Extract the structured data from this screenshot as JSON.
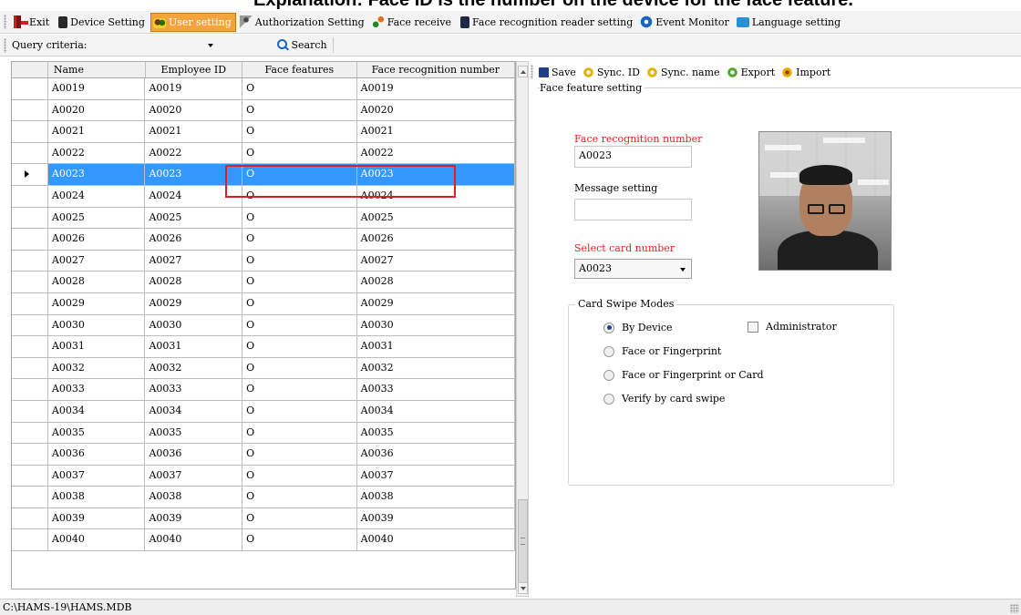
{
  "caption": "Explanation: Face ID is the number on the device for the face feature.",
  "menubar": {
    "items": [
      {
        "label": "Exit",
        "icon": "exit-icon",
        "active": false
      },
      {
        "label": "Device Setting",
        "icon": "device-icon",
        "active": false
      },
      {
        "label": "User setting",
        "icon": "user-setting-icon",
        "active": true
      },
      {
        "label": "Authorization Setting",
        "icon": "authorization-icon",
        "active": false
      },
      {
        "label": "Face receive",
        "icon": "face-receive-icon",
        "active": false
      },
      {
        "label": "Face recognition reader setting",
        "icon": "reader-icon",
        "active": false
      },
      {
        "label": "Event Monitor",
        "icon": "event-monitor-icon",
        "active": false
      },
      {
        "label": "Language setting",
        "icon": "language-icon",
        "active": false
      }
    ]
  },
  "query": {
    "label": "Query criteria:",
    "value": "",
    "search_label": "Search"
  },
  "grid": {
    "columns": [
      "Name",
      "Employee ID",
      "Face features",
      "Face recognition number"
    ],
    "selected_index": 4,
    "rows": [
      [
        "A0019",
        "A0019",
        "O",
        "A0019"
      ],
      [
        "A0020",
        "A0020",
        "O",
        "A0020"
      ],
      [
        "A0021",
        "A0021",
        "O",
        "A0021"
      ],
      [
        "A0022",
        "A0022",
        "O",
        "A0022"
      ],
      [
        "A0023",
        "A0023",
        "O",
        "A0023"
      ],
      [
        "A0024",
        "A0024",
        "O",
        "A0024"
      ],
      [
        "A0025",
        "A0025",
        "O",
        "A0025"
      ],
      [
        "A0026",
        "A0026",
        "O",
        "A0026"
      ],
      [
        "A0027",
        "A0027",
        "O",
        "A0027"
      ],
      [
        "A0028",
        "A0028",
        "O",
        "A0028"
      ],
      [
        "A0029",
        "A0029",
        "O",
        "A0029"
      ],
      [
        "A0030",
        "A0030",
        "O",
        "A0030"
      ],
      [
        "A0031",
        "A0031",
        "O",
        "A0031"
      ],
      [
        "A0032",
        "A0032",
        "O",
        "A0032"
      ],
      [
        "A0033",
        "A0033",
        "O",
        "A0033"
      ],
      [
        "A0034",
        "A0034",
        "O",
        "A0034"
      ],
      [
        "A0035",
        "A0035",
        "O",
        "A0035"
      ],
      [
        "A0036",
        "A0036",
        "O",
        "A0036"
      ],
      [
        "A0037",
        "A0037",
        "O",
        "A0037"
      ],
      [
        "A0038",
        "A0038",
        "O",
        "A0038"
      ],
      [
        "A0039",
        "A0039",
        "O",
        "A0039"
      ],
      [
        "A0040",
        "A0040",
        "O",
        "A0040"
      ]
    ]
  },
  "toolbar": {
    "save": "Save",
    "sync_id": "Sync. ID",
    "sync_name": "Sync. name",
    "export": "Export",
    "import": "Import"
  },
  "face_setting": {
    "group_title": "Face feature setting",
    "recognition_label": "Face recognition number",
    "recognition_value": "A0023",
    "message_label": "Message setting",
    "message_value": "",
    "card_label": "Select card number",
    "card_value": "A0023"
  },
  "modes": {
    "title": "Card Swipe Modes",
    "options": [
      "By Device",
      "Face or Fingerprint",
      "Face or Fingerprint or Card",
      "Verify by card swipe"
    ],
    "selected": "By Device",
    "admin_label": "Administrator",
    "admin_checked": false
  },
  "status": {
    "path": "C:\\HAMS-19\\HAMS.MDB"
  },
  "colors": {
    "accent": "#3399ff",
    "required_label": "#e52020",
    "active_menu": "#f7a33b",
    "highlight_box": "#e02020"
  }
}
